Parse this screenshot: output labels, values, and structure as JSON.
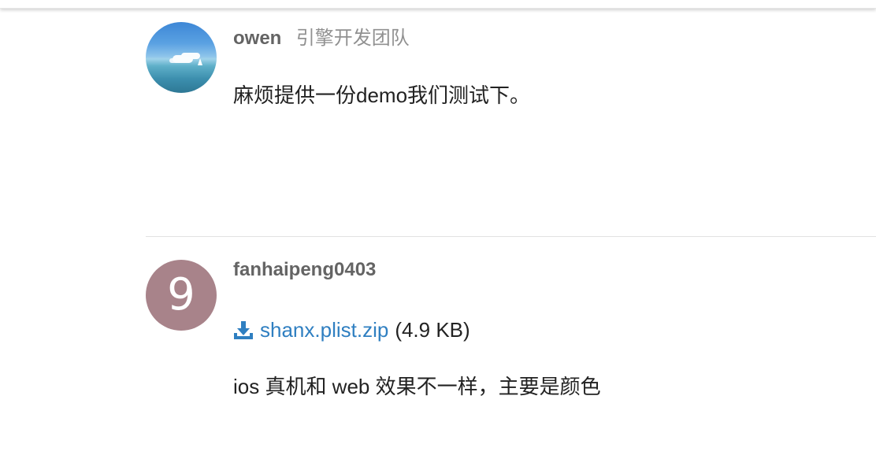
{
  "posts": [
    {
      "username": "owen",
      "user_title": "引擎开发团队",
      "avatar": {
        "type": "photo",
        "icon": "ocean-sailboat-avatar"
      },
      "body": "麻烦提供一份demo我们测试下。"
    },
    {
      "username": "fanhaipeng0403",
      "avatar": {
        "type": "letter",
        "letter": "9",
        "color": "#a8838a"
      },
      "attachment": {
        "icon": "download-icon",
        "filename": "shanx.plist.zip",
        "size": "(4.9 KB)"
      },
      "body": "ios 真机和 web 效果不一样，主要是颜色"
    }
  ],
  "colors": {
    "link": "#2f7fc1",
    "username": "#646464",
    "user_title": "#919191",
    "text": "#222222",
    "divider": "#e2e2e2"
  }
}
